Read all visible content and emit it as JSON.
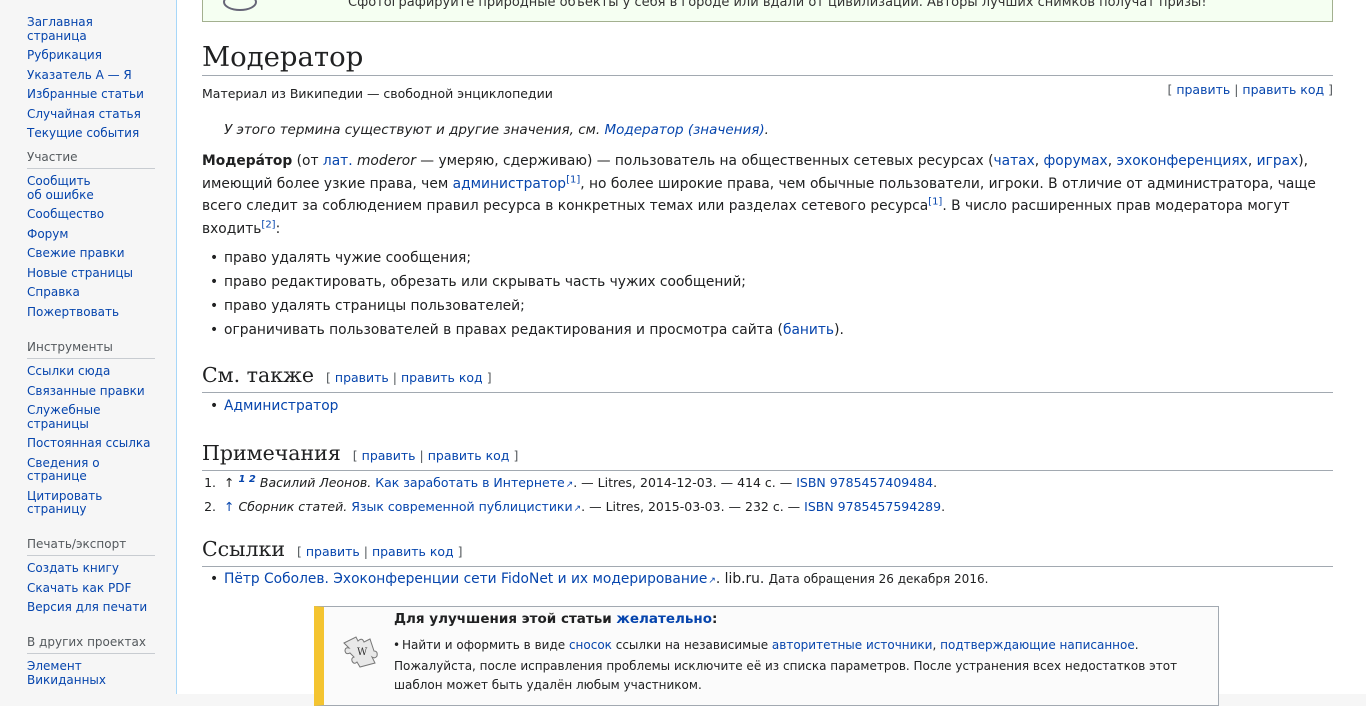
{
  "sidebar": {
    "nav": [
      "Заглавная страница",
      "Рубрикация",
      "Указатель А — Я",
      "Избранные статьи",
      "Случайная статья",
      "Текущие события"
    ],
    "participation": {
      "heading": "Участие",
      "items": [
        "Сообщить об ошибке",
        "Сообщество",
        "Форум",
        "Свежие правки",
        "Новые страницы",
        "Справка",
        "Пожертвовать"
      ]
    },
    "tools": {
      "heading": "Инструменты",
      "items": [
        "Ссылки сюда",
        "Связанные правки",
        "Служебные страницы",
        "Постоянная ссылка",
        "Сведения о странице",
        "Цитировать страницу"
      ]
    },
    "print": {
      "heading": "Печать/экспорт",
      "items": [
        "Создать книгу",
        "Скачать как PDF",
        "Версия для печати"
      ]
    },
    "projects": {
      "heading": "В других проектах",
      "items": [
        "Элемент Викиданных"
      ]
    }
  },
  "sitenotice": "Сфотографируйте природные объекты у себя в городе или вдали от цивилизации. Авторы лучших снимков получат призы!",
  "article": {
    "title": "Модератор",
    "tagline": "Материал из Википедии — свободной энциклопедии",
    "edit": "править",
    "edit_code": "править код",
    "hatnote_text": "У этого термина существуют и другие значения, см. ",
    "hatnote_link": "Модератор (значения)",
    "lead": {
      "term": "Модера́тор",
      "p1": " (от ",
      "lat": "лат.",
      "moderor": "moderor",
      "p2": " — умеряю, сдерживаю) — пользователь на общественных сетевых ресурсах (",
      "chats": "чатах",
      "forums": "форумах",
      "echo": "эхоконференциях",
      "games": "играх",
      "p3": "), имеющий более узкие права, чем ",
      "admins": "администратор",
      "ref1": "[1]",
      "p4": ", но более широкие права, чем обычные пользователи, игроки. В отличие от администратора, чаще всего следит за соблюдением правил ресурса в конкретных темах или разделах сетевого ресурса",
      "p5": ". В число расширенных прав модератора могут входить",
      "ref2": "[2]"
    },
    "rights": [
      "право удалять чужие сообщения;",
      "право редактировать, обрезать или скрывать часть чужих сообщений;",
      "право удалять страницы пользователей;"
    ],
    "right4_text": "ограничивать пользователей в правах редактирования и просмотра сайта (",
    "right4_link": "банить",
    "right4_end": ").",
    "seealso_heading": "См. также",
    "seealso": [
      "Администратор"
    ],
    "notes_heading": "Примечания",
    "refs": [
      {
        "num": "1.",
        "back": "↑",
        "backs": [
          "1",
          "2"
        ],
        "author": "Василий Леонов.",
        "title": "Как заработать в Интернете",
        "rest": ". — Litres, 2014-12-03. — 414 с. — ",
        "isbn": "ISBN 9785457409484"
      },
      {
        "num": "2.",
        "back": "↑",
        "author": "Сборник статей.",
        "title": "Язык современной публицистики",
        "rest": ". — Litres, 2015-03-03. — 232 с. — ",
        "isbn": "ISBN 9785457594289"
      }
    ],
    "links_heading": "Ссылки",
    "extlink": {
      "title": "Пётр Соболев. Эхоконференции сети FidoNet и их модерирование",
      "site": ". lib.ru.",
      "accessed": "Дата обращения 26 декабря 2016."
    },
    "ambox": {
      "title": "Для улучшения этой статьи ",
      "title_link": "желательно",
      "item_p1": "Найти и оформить в виде ",
      "item_l1": "сносок",
      "item_p2": " ссылки на независимые ",
      "item_l2": "авторитетные источники",
      "item_l3": "подтверждающие написанное",
      "text": "Пожалуйста, после исправления проблемы исключите её из списка параметров. После устранения всех недостатков этот шаблон может быть удалён любым участником."
    }
  }
}
